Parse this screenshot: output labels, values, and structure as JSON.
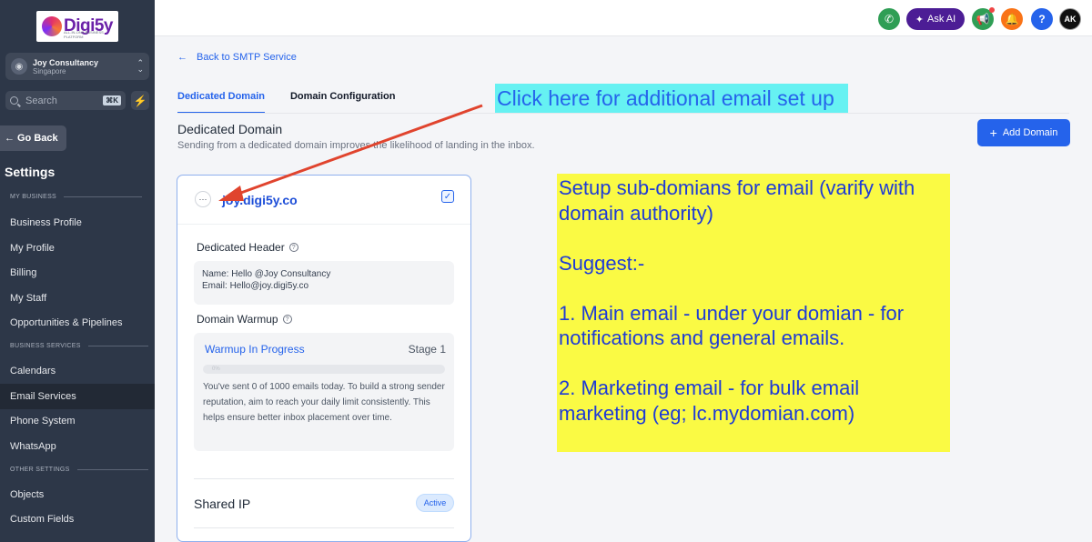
{
  "brand": {
    "name": "Digi5y",
    "tagline": "ALL-IN-ONE BUSINESS PLATFORM"
  },
  "account": {
    "name": "Joy Consultancy",
    "location": "Singapore"
  },
  "search": {
    "placeholder": "Search",
    "shortcut": "⌘K"
  },
  "sidebar": {
    "go_back": "Go Back",
    "title": "Settings",
    "sections": {
      "my_business": "MY BUSINESS",
      "business_services": "BUSINESS SERVICES",
      "other_settings": "OTHER SETTINGS"
    },
    "items": [
      "Business Profile",
      "My Profile",
      "Billing",
      "My Staff",
      "Opportunities & Pipelines",
      "Calendars",
      "Email Services",
      "Phone System",
      "WhatsApp",
      "Objects",
      "Custom Fields"
    ],
    "active_item": "Email Services"
  },
  "topbar": {
    "ask_ai": "Ask AI",
    "avatar_initials": "AK"
  },
  "main": {
    "back_link": "Back to SMTP Service",
    "tabs": [
      "Dedicated Domain",
      "Domain Configuration"
    ],
    "section_title": "Dedicated Domain",
    "section_subtitle": "Sending from a dedicated domain improves the likelihood of landing in the inbox.",
    "add_domain": "Add Domain"
  },
  "card": {
    "domain": "joy.digi5y.co",
    "dedicated_header_label": "Dedicated Header",
    "name_label": "Name:",
    "name_value": "Hello @Joy Consultancy",
    "email_label": "Email:",
    "email_value": "Hello@joy.digi5y.co",
    "warmup_label": "Domain Warmup",
    "warmup_status": "Warmup In Progress",
    "warmup_stage": "Stage 1",
    "warmup_progress": "0%",
    "warmup_progress_value": 0,
    "warmup_text": "You've sent 0 of 1000 emails today. To build a strong sender reputation, aim to reach your daily limit consistently. This helps ensure better inbox placement over time.",
    "shared_ip_label": "Shared IP",
    "shared_ip_status": "Active"
  },
  "annotations": {
    "callout": "Click here for additional email set up",
    "note": "Setup sub-domians for email (varify with domain authority)\n\nSuggest:-\n\n1. Main email - under your domian - for notifications and general emails.\n\n2. Marketing email - for bulk email marketing (eg; lc.mydomian.com)"
  },
  "colors": {
    "sidebar_bg": "#2d3748",
    "accent": "#2563eb",
    "callout_bg": "#66f1f2",
    "note_bg": "#fafa44",
    "arrow": "#e0442e"
  }
}
